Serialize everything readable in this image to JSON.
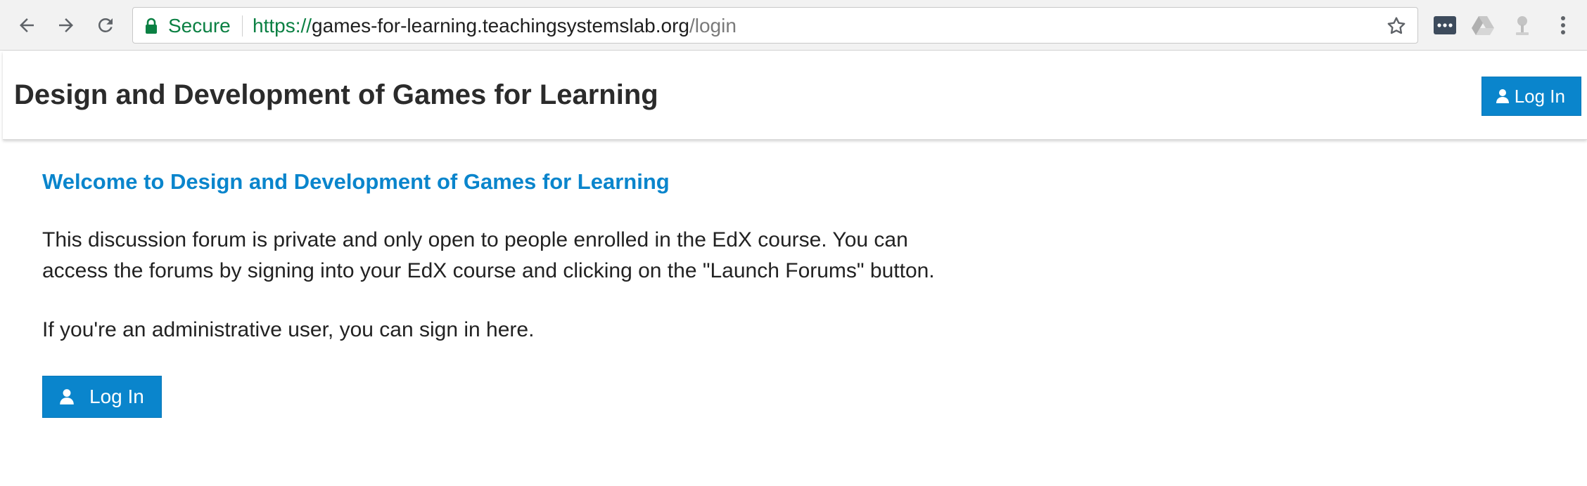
{
  "browser": {
    "secure_label": "Secure",
    "url_scheme": "https://",
    "url_host": "games-for-learning.teachingsystemslab.org",
    "url_path": "/login",
    "icons": [
      "back-arrow-icon",
      "forward-arrow-icon",
      "reload-icon",
      "lock-icon",
      "star-icon",
      "password-manager-icon",
      "drive-icon",
      "extension-icon",
      "menu-icon"
    ]
  },
  "header": {
    "title": "Design and Development of Games for Learning",
    "login_label": "Log In"
  },
  "main": {
    "welcome": "Welcome to Design and Development of Games for Learning",
    "paragraph_1_line_1": "This discussion forum is private and only open to people enrolled in the EdX course. You can",
    "paragraph_1_line_2": "access the forums by signing into your EdX course and clicking on the \"Launch Forums\" button.",
    "paragraph_2": "If you're an administrative user, you can sign in here.",
    "login_label": "Log In"
  },
  "colors": {
    "accent": "#0a85cc",
    "secure_green": "#0b8043",
    "text": "#222222"
  }
}
